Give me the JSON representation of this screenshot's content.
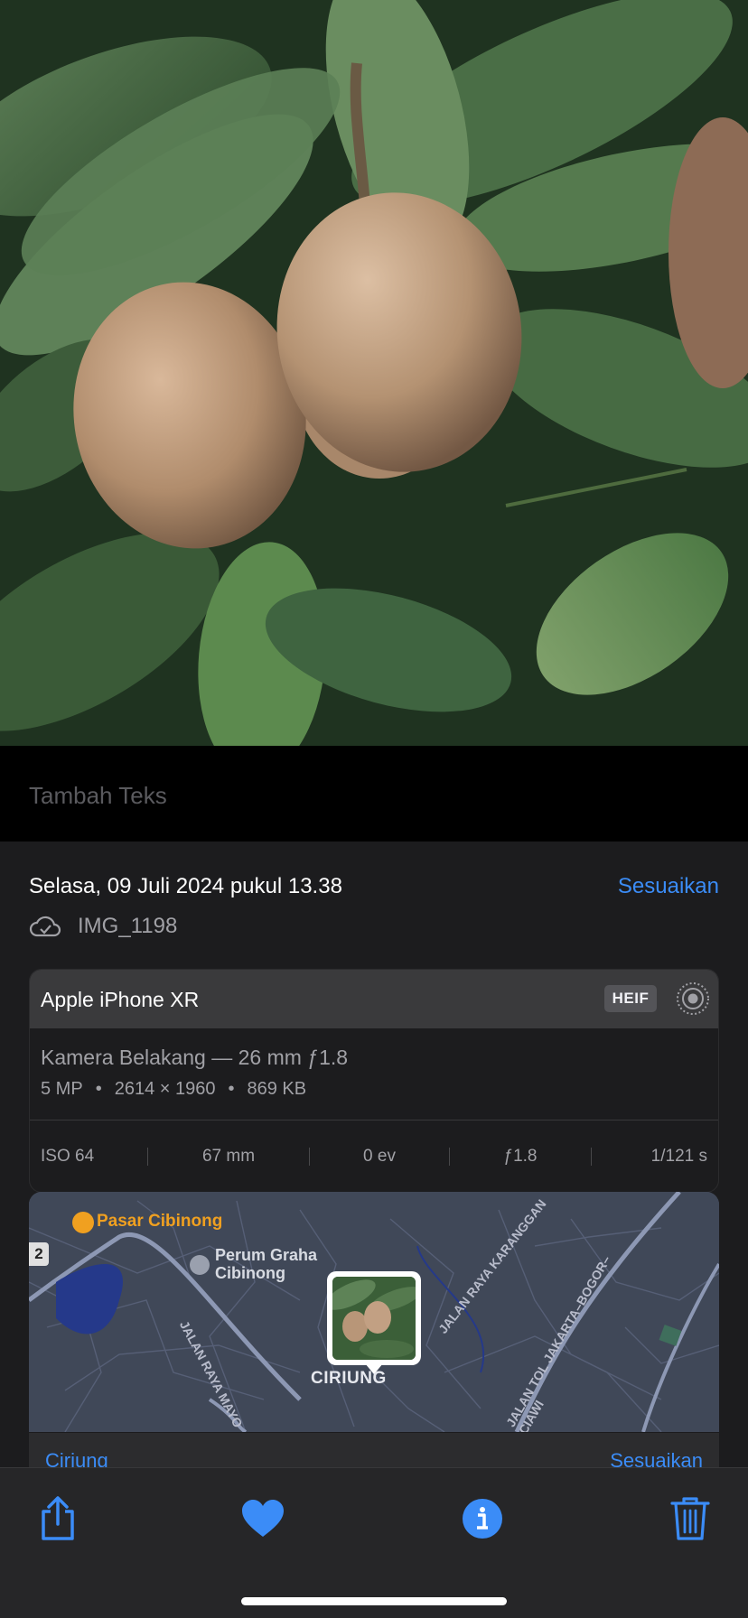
{
  "caption": {
    "placeholder": "Tambah Teks"
  },
  "info": {
    "date": "Selasa, 09 Juli 2024 pukul 13.38",
    "adjust_label": "Sesuaikan",
    "filename": "IMG_1198",
    "cloud_icon": "icloud-check-icon"
  },
  "camera": {
    "device": "Apple iPhone XR",
    "format": "HEIF",
    "live_icon": "live-photo-icon",
    "lens": "Kamera Belakang — 26 mm ƒ1.8",
    "resolution": "5 MP",
    "dimensions": "2614 × 1960",
    "filesize": "869 KB",
    "dot": "•",
    "exif": {
      "iso": "ISO 64",
      "focal": "67 mm",
      "ev": "0 ev",
      "aperture": "ƒ1.8",
      "shutter": "1/121 s"
    }
  },
  "map": {
    "poi_market": "Pasar Cibinong",
    "poi_housing_1": "Perum Graha",
    "poi_housing_2": "Cibinong",
    "district": "CIRIUNG",
    "road_1": "JALAN RAYA MAYO",
    "road_2": "JALAN RAYA KARANGGAN",
    "road_3": "JALAN TOL JAKARTA–BOGOR–CIAWI",
    "route_badge": "2",
    "location_link": "Ciriung",
    "adjust_label": "Sesuaikan"
  },
  "toolbar": {
    "share_icon": "share-icon",
    "favorite_icon": "heart-icon",
    "info_icon": "info-icon",
    "delete_icon": "trash-icon"
  },
  "colors": {
    "accent": "#3b8cf7",
    "background": "#1c1c1e",
    "market_poi": "#f0a020"
  }
}
